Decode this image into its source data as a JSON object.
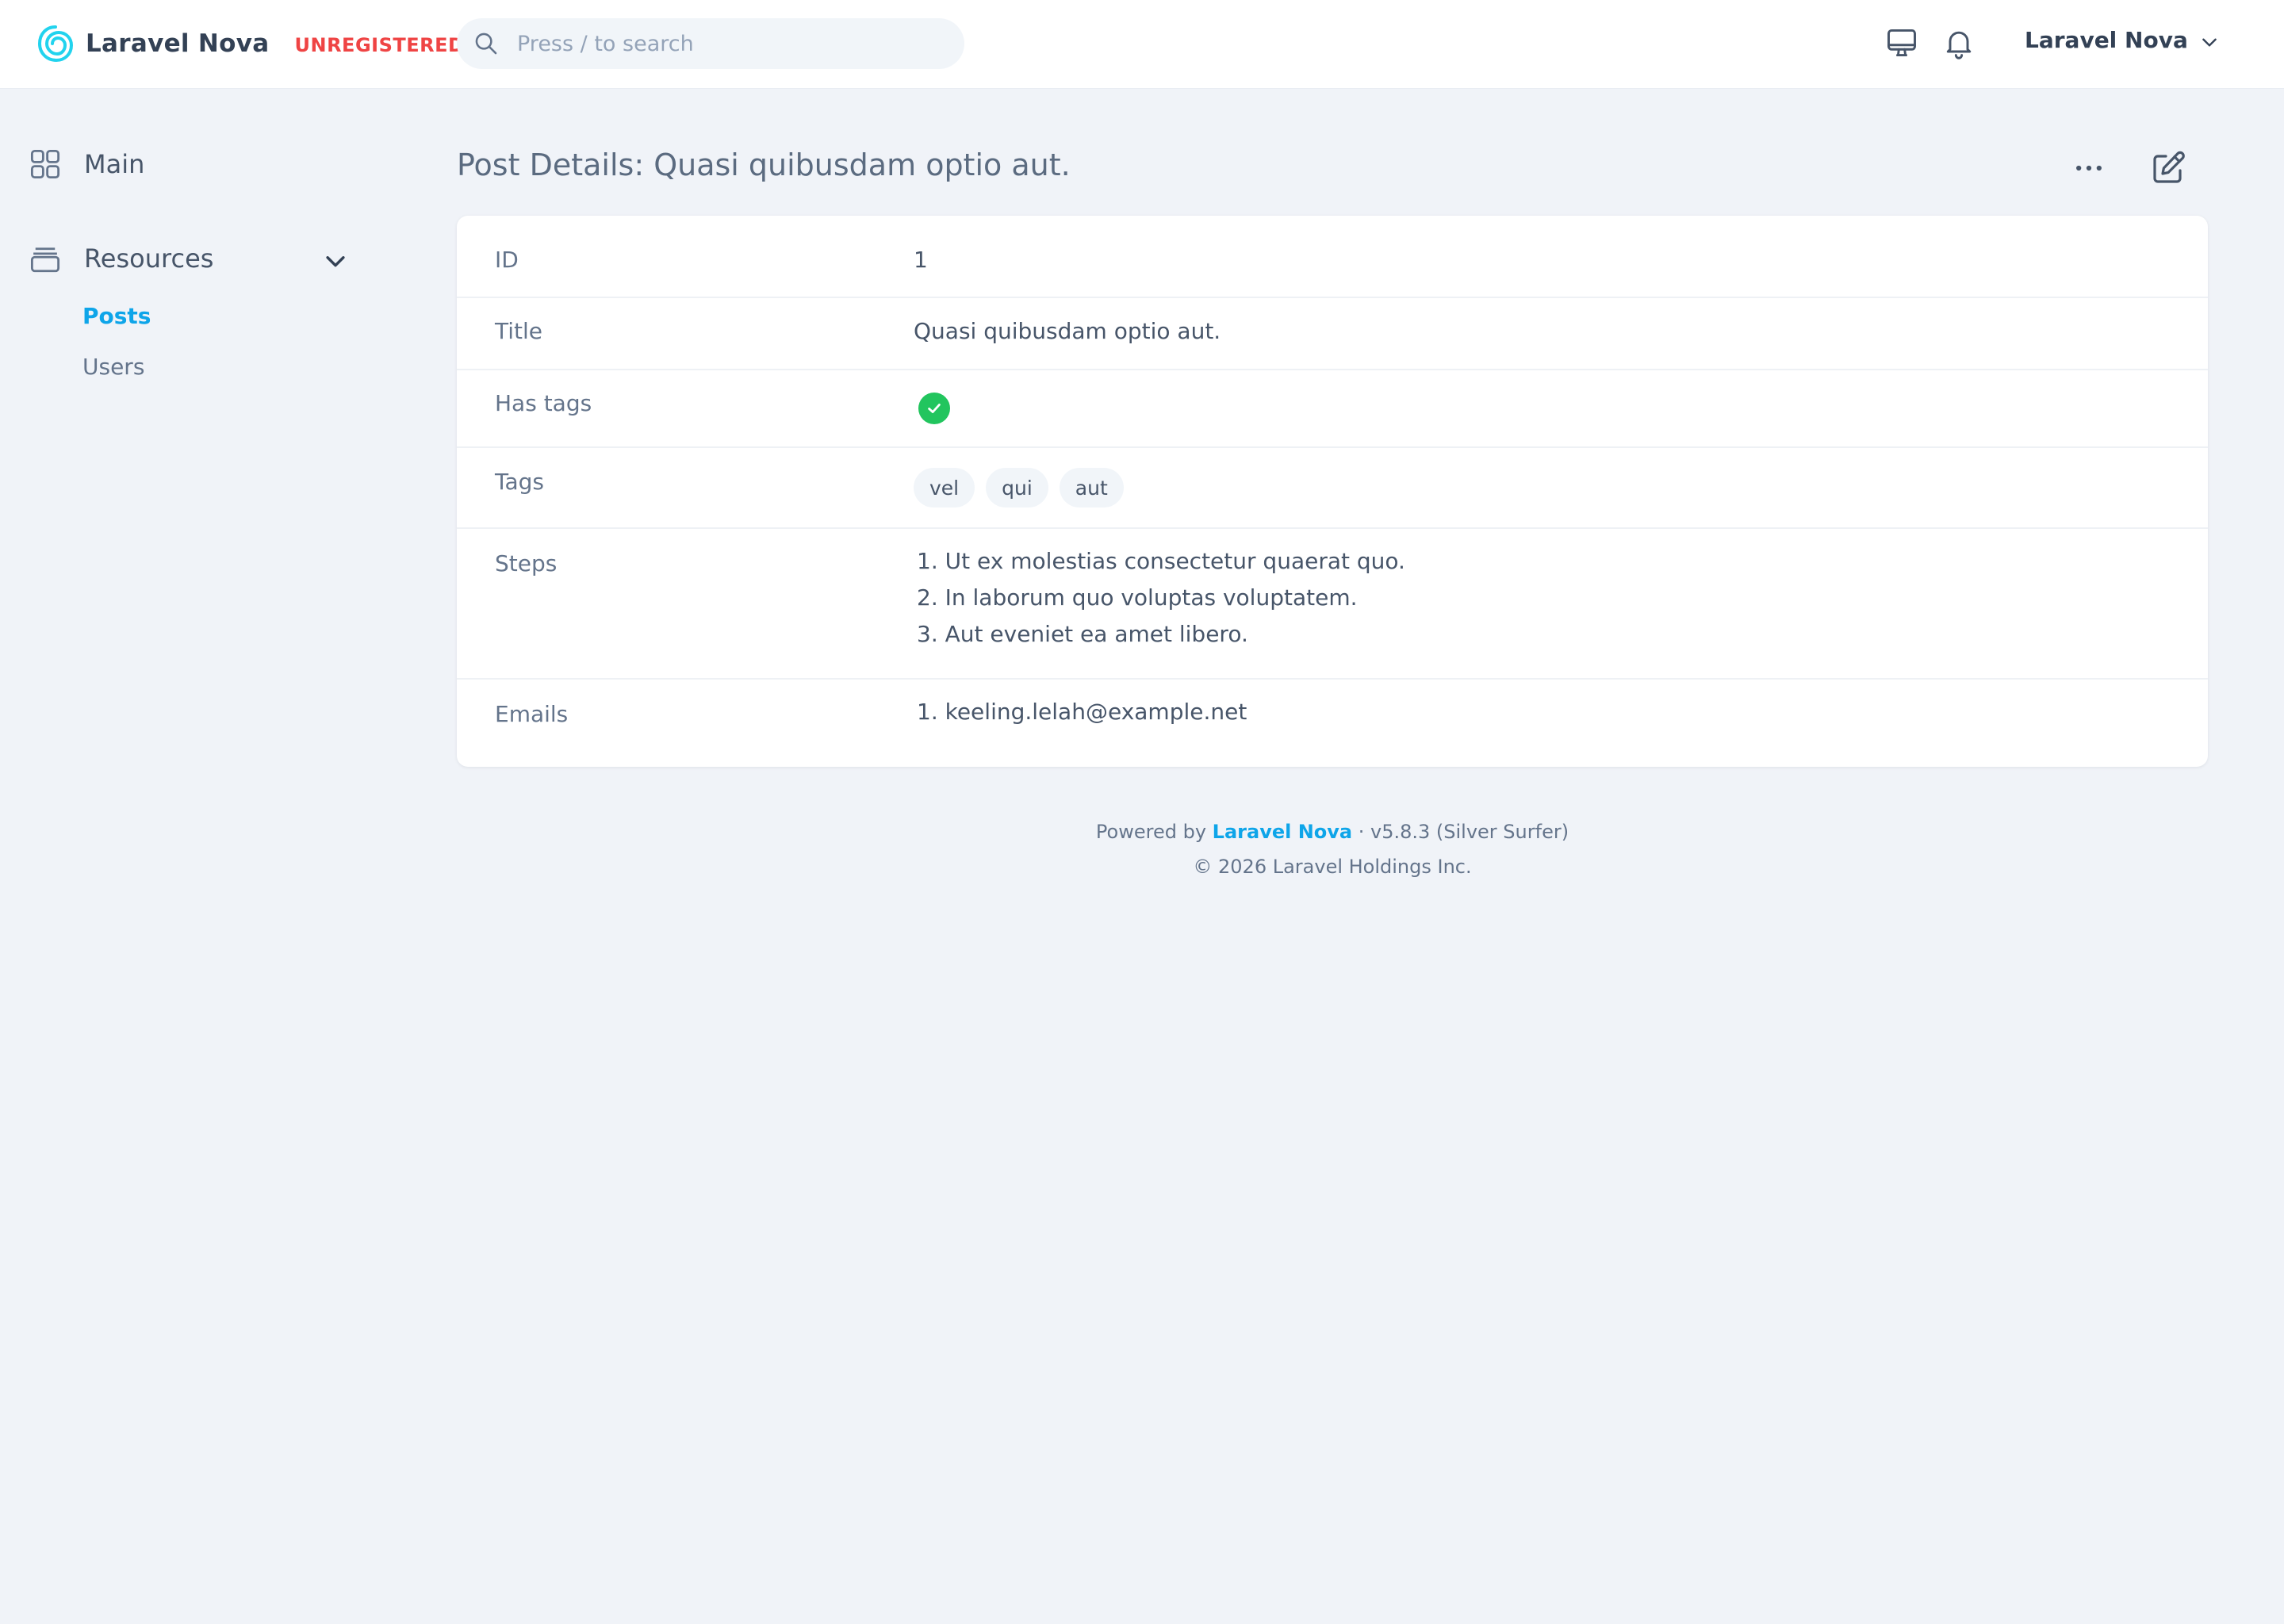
{
  "header": {
    "brand_name": "Laravel Nova",
    "license_badge": "UNREGISTERED",
    "search_placeholder": "Press / to search",
    "user_name": "Laravel Nova"
  },
  "sidebar": {
    "main_label": "Main",
    "resources_label": "Resources",
    "items": [
      {
        "label": "Posts",
        "active": true
      },
      {
        "label": "Users",
        "active": false
      }
    ]
  },
  "page": {
    "title": "Post Details: Quasi quibusdam optio aut."
  },
  "details": {
    "id": {
      "label": "ID",
      "value": "1"
    },
    "title": {
      "label": "Title",
      "value": "Quasi quibusdam optio aut."
    },
    "has_tags": {
      "label": "Has tags",
      "value": true
    },
    "tags": {
      "label": "Tags",
      "values": [
        "vel",
        "qui",
        "aut"
      ]
    },
    "steps": {
      "label": "Steps",
      "values": [
        "1. Ut ex molestias consectetur quaerat quo.",
        "2. In laborum quo voluptas voluptatem.",
        "3. Aut eveniet ea amet libero."
      ]
    },
    "emails": {
      "label": "Emails",
      "values": [
        "1. keeling.lelah@example.net"
      ]
    }
  },
  "footer": {
    "powered_prefix": "Powered by",
    "powered_link": "Laravel Nova",
    "version": "· v5.8.3 (Silver Surfer)",
    "copyright": "© 2026 Laravel Holdings Inc."
  },
  "colors": {
    "accent": "#0ea5e9",
    "badge_red": "#ef4444",
    "success_green": "#22c55e",
    "background": "#f0f3f8"
  },
  "icons": {
    "logo": "nova-swirl-logo",
    "search": "search-icon",
    "theme": "monitor-icon",
    "notifications": "bell-icon",
    "user_menu": "chevron-down-icon",
    "main": "grid-icon",
    "resources": "archive-box-icon",
    "more_actions": "ellipsis-icon",
    "edit": "pencil-square-icon",
    "has_tags": "check-icon"
  }
}
